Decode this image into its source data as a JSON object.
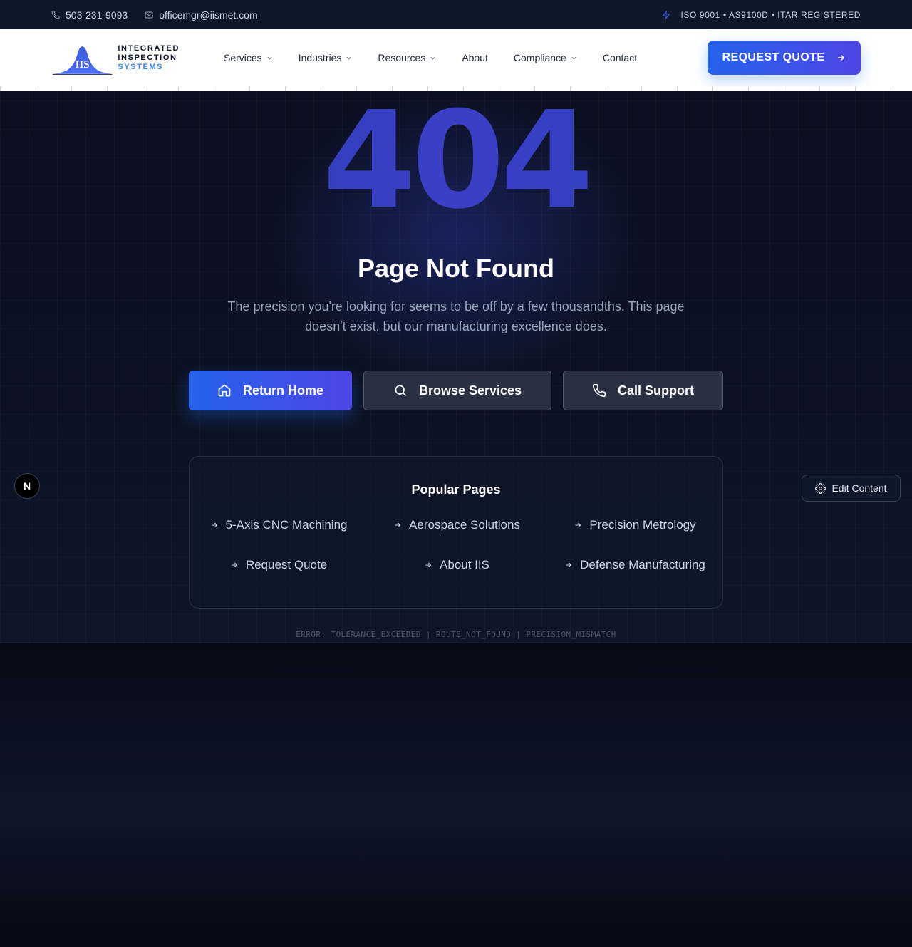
{
  "topbar": {
    "phone": "503-231-9093",
    "email": "officemgr@iismet.com",
    "certifications": "ISO 9001 • AS9100D • ITAR REGISTERED"
  },
  "logo": {
    "mark": "IIS",
    "line1": "INTEGRATED",
    "line2": "INSPECTION",
    "line3": "SYSTEMS"
  },
  "nav": {
    "items": [
      {
        "label": "Services",
        "dropdown": true
      },
      {
        "label": "Industries",
        "dropdown": true
      },
      {
        "label": "Resources",
        "dropdown": true
      },
      {
        "label": "About",
        "dropdown": false
      },
      {
        "label": "Compliance",
        "dropdown": true
      },
      {
        "label": "Contact",
        "dropdown": false
      }
    ],
    "cta": "REQUEST QUOTE"
  },
  "hero": {
    "code": "404",
    "title": "Page Not Found",
    "description": "The precision you're looking for seems to be off by a few thousandths. This page doesn't exist, but our manufacturing excellence does.",
    "buttons": {
      "home": "Return Home",
      "services": "Browse Services",
      "support": "Call Support"
    }
  },
  "popular": {
    "heading": "Popular Pages",
    "links": [
      "5-Axis CNC Machining",
      "Aerospace Solutions",
      "Precision Metrology",
      "Request Quote",
      "About IIS",
      "Defense Manufacturing"
    ]
  },
  "error_line": "ERROR: TOLERANCE_EXCEEDED | ROUTE_NOT_FOUND | PRECISION_MISMATCH",
  "floating": {
    "next_badge": "N",
    "edit": "Edit Content"
  },
  "colors": {
    "accent": "#2563eb",
    "accent2": "#4f46e5",
    "background": "#0b1120"
  }
}
